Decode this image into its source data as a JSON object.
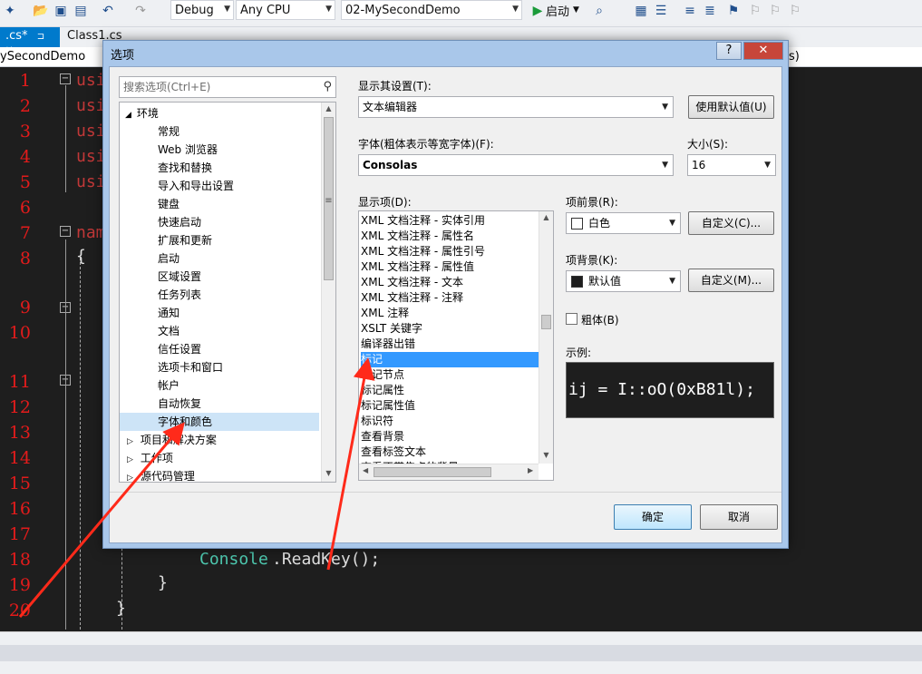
{
  "toolbar": {
    "config": "Debug",
    "platform": "Any CPU",
    "project": "02-MySecondDemo",
    "start_label": "启动"
  },
  "tabs": [
    {
      "label": ".cs*",
      "pin": "⊐ ✕"
    },
    {
      "label": "Class1.cs"
    }
  ],
  "navbar": {
    "left": "ySecondDemo",
    "right": "s)"
  },
  "editor": {
    "line_numbers": [
      "1",
      "2",
      "3",
      "4",
      "5",
      "6",
      "7",
      "8",
      "9",
      "10",
      "11",
      "12",
      "13",
      "14",
      "15",
      "16",
      "17",
      "18",
      "19",
      "20"
    ],
    "code": {
      "using1": "usi",
      "using2": "usi",
      "using3": "usi",
      "using4": "usi",
      "using5": "usi",
      "namespace": "nam",
      "brace_open": "{",
      "console_class": "Console",
      "readkey_call": ".ReadKey();",
      "brace_inner_close": "}",
      "brace_close": "}"
    }
  },
  "dialog": {
    "title": "选项",
    "help_btn": "?",
    "close_btn": "✕",
    "search_placeholder": "搜索选项(Ctrl+E)",
    "tree": {
      "root": "环境",
      "children": [
        "常规",
        "Web 浏览器",
        "查找和替换",
        "导入和导出设置",
        "键盘",
        "快速启动",
        "扩展和更新",
        "启动",
        "区域设置",
        "任务列表",
        "通知",
        "文档",
        "信任设置",
        "选项卡和窗口",
        "帐户",
        "自动恢复",
        "字体和颜色"
      ],
      "selected_index": 16,
      "siblings": [
        "项目和解决方案",
        "工作项",
        "源代码管理"
      ]
    },
    "show_settings_for_label": "显示其设置(T):",
    "show_settings_for_value": "文本编辑器",
    "use_defaults_btn": "使用默认值(U)",
    "font_label": "字体(粗体表示等宽字体)(F):",
    "font_value": "Consolas",
    "size_label": "大小(S):",
    "size_value": "16",
    "display_items_label": "显示项(D):",
    "display_items": [
      "XML 文档注释 - 实体引用",
      "XML 文档注释 - 属性名",
      "XML 文档注释 - 属性引号",
      "XML 文档注释 - 属性值",
      "XML 文档注释 - 文本",
      "XML 文档注释 - 注释",
      "XML 注释",
      "XSLT 关键字",
      "编译器出错",
      "标记",
      "标记节点",
      "标记属性",
      "标记属性值",
      "标识符",
      "查看背景",
      "查看标签文本",
      "查看不带焦点的背景"
    ],
    "display_selected_index": 9,
    "fg_label": "项前景(R):",
    "fg_value": "白色",
    "bg_label": "项背景(K):",
    "bg_value": "默认值",
    "custom_fg_btn": "自定义(C)...",
    "custom_bg_btn": "自定义(M)...",
    "bold_label": "粗体(B)",
    "sample_label": "示例:",
    "sample_text": "ij = I::oO(0xB81l);",
    "ok_btn": "确定",
    "cancel_btn": "取消"
  },
  "colors": {
    "accent": "#007acc",
    "selection": "#3399ff",
    "line_number": "#e31b1b",
    "annotation_arrow": "#ff2a1a"
  }
}
